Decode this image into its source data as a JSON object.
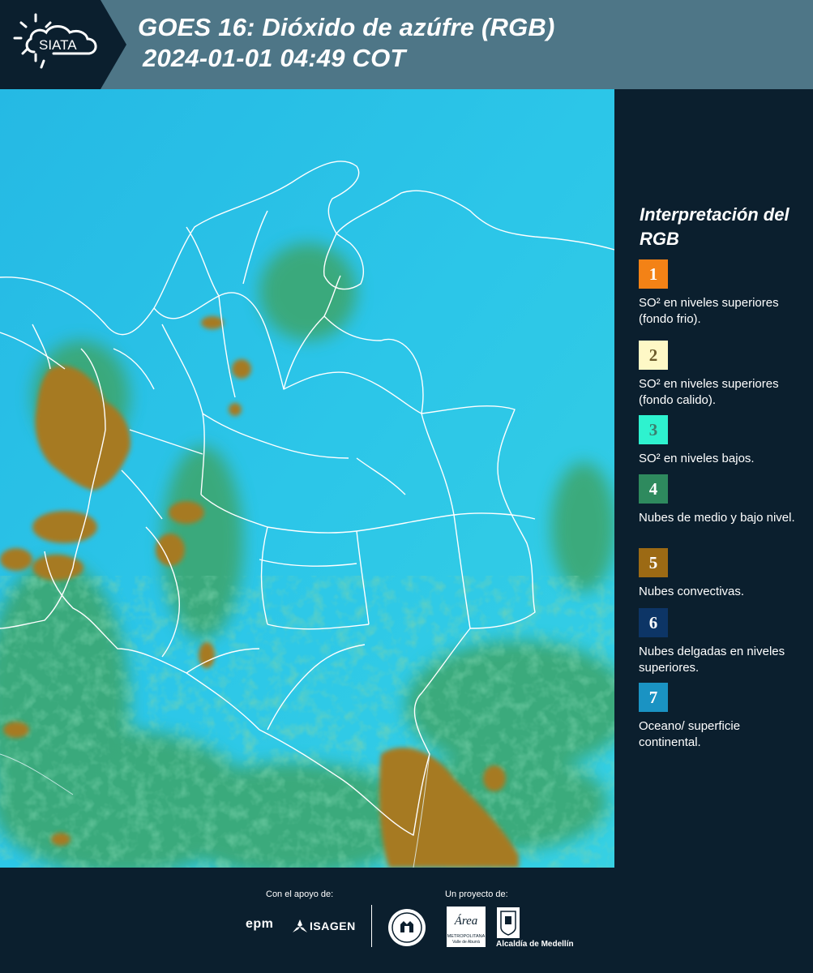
{
  "header": {
    "brand": "SIATA",
    "title_line1": "GOES 16: Dióxido de azúfre (RGB)",
    "title_line2": "2024-01-01 04:49 COT",
    "logo_icon": "sun-cloud-icon",
    "background_color": "#4e7687"
  },
  "map": {
    "content": "satellite-rgb-image",
    "ocean_surface_color": "#27c2e6",
    "low_cloud_color": "#3aa86a",
    "convective_color": "#a77a1e",
    "boundary_color": "#ffffff"
  },
  "legend": {
    "title": "Interpretación del RGB",
    "items": [
      {
        "number": "1",
        "label": "SO² en niveles superiores (fondo frio).",
        "color": "#f38216",
        "number_color": "#ffffff"
      },
      {
        "number": "2",
        "label": "SO² en niveles superiores (fondo calido).",
        "color": "#fef8c6",
        "number_color": "#6a5a2a"
      },
      {
        "number": "3",
        "label": "SO² en niveles bajos.",
        "color": "#2ef2cf",
        "number_color": "#3b7f6e"
      },
      {
        "number": "4",
        "label": "Nubes de medio y bajo nivel.",
        "color": "#2e8a5e",
        "number_color": "#ffffff"
      },
      {
        "number": "5",
        "label": "Nubes convectivas.",
        "color": "#9c6a14",
        "number_color": "#ffffff"
      },
      {
        "number": "6",
        "label": "Nubes delgadas en niveles superiores.",
        "color": "#0d3566",
        "number_color": "#ffffff"
      },
      {
        "number": "7",
        "label": "Oceano/ superficie continental.",
        "color": "#1a93c3",
        "number_color": "#ffffff"
      }
    ]
  },
  "footer": {
    "support_caption": "Con el apoyo de:",
    "project_caption": "Un proyecto de:",
    "sponsors": [
      "epm",
      "ISAGEN"
    ],
    "partners": [
      "Alcaldía de Medellín"
    ],
    "area_logo_text": [
      "Área",
      "METROPOLITANA",
      "Valle de Aburrá"
    ]
  }
}
